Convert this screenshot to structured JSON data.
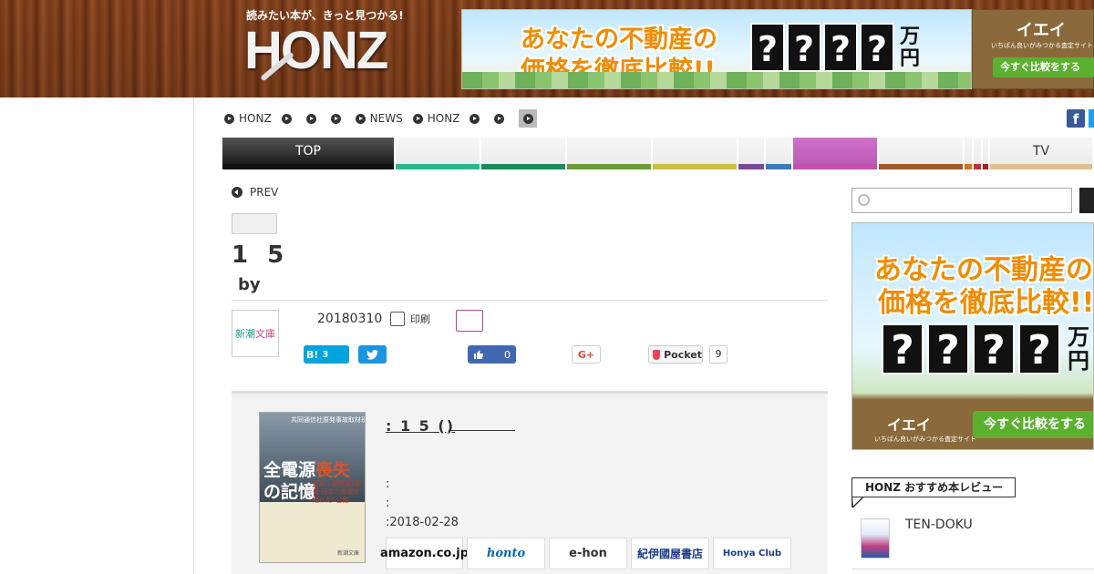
{
  "header": {
    "tagline": "読みたい本が、きっと見つかる!",
    "logo": "HONZ"
  },
  "top_banner": {
    "line1": "あなたの不動産の",
    "line2": "価格を徹底比較!!",
    "placeholder_digits": [
      "?",
      "?",
      "?",
      "?"
    ],
    "unit": "万円",
    "brand": "イエイ",
    "brand_sub": "いちばん良いがみつかる査定サイト",
    "cta": "今すぐ比較をする"
  },
  "breadcrumb": {
    "items": [
      "HONZ",
      "",
      "",
      "",
      "NEWS",
      "HONZ",
      "",
      ""
    ]
  },
  "nav": {
    "tabs": [
      {
        "label": "TOP",
        "color": "#111111"
      },
      {
        "label": "",
        "color": "#2bb88f"
      },
      {
        "label": "",
        "color": "#1a8a5a"
      },
      {
        "label": "",
        "color": "#6a9a3a"
      },
      {
        "label": "",
        "color": "#c8c040"
      },
      {
        "label": "",
        "color": "#7a4a9a"
      },
      {
        "label": "",
        "color": "#3a7ab8"
      },
      {
        "label": "",
        "color": "#c050b0"
      },
      {
        "label": "",
        "color": "#9a5a2a"
      },
      {
        "label": "",
        "color": "#d0702a"
      },
      {
        "label": "",
        "color": "#c03030"
      },
      {
        "label": "",
        "color": "#a02020"
      },
      {
        "label": "TV",
        "color": "#e0c090"
      }
    ]
  },
  "article": {
    "prev_label": "PREV",
    "title": "1 5",
    "byline": "by",
    "publisher_logo": {
      "part1": "新潮",
      "part2": "文庫"
    },
    "date": "20180310",
    "print_label": "印刷"
  },
  "share": {
    "hatena_label": "B!",
    "hatena_count": "3",
    "fb_count": "0",
    "gplus_label": "G+",
    "pocket_label": "Pocket",
    "pocket_count": "9"
  },
  "book": {
    "cover": {
      "publisher": "共同通信社原発事故取材班",
      "title_a": "全電源",
      "title_b": "喪失",
      "title_c": "の記憶",
      "subtitle": "証言・福島第1原発 日本の命運を賭けた5日間",
      "imprint": "新潮文庫"
    },
    "title": ": 1 5 ()",
    "meta1": ":",
    "meta2": ":",
    "meta3": ":2018-02-28"
  },
  "shops": [
    "amazon.co.jp",
    "honto",
    "e-hon",
    "紀伊國屋書店",
    "Honya Club"
  ],
  "sidebar": {
    "search_placeholder": "",
    "ad": {
      "line1": "あなたの不動産の",
      "line2": "価格を徹底比較!!",
      "digits": [
        "?",
        "?",
        "?",
        "?"
      ],
      "unit": "万円",
      "brand": "イエイ",
      "brand_sub": "いちばん良いがみつかる査定サイト",
      "cta": "今すぐ比較をする"
    },
    "recommend_title": "HONZ おすすめ本レビュー",
    "recommend_item": "TEN-DOKU"
  }
}
